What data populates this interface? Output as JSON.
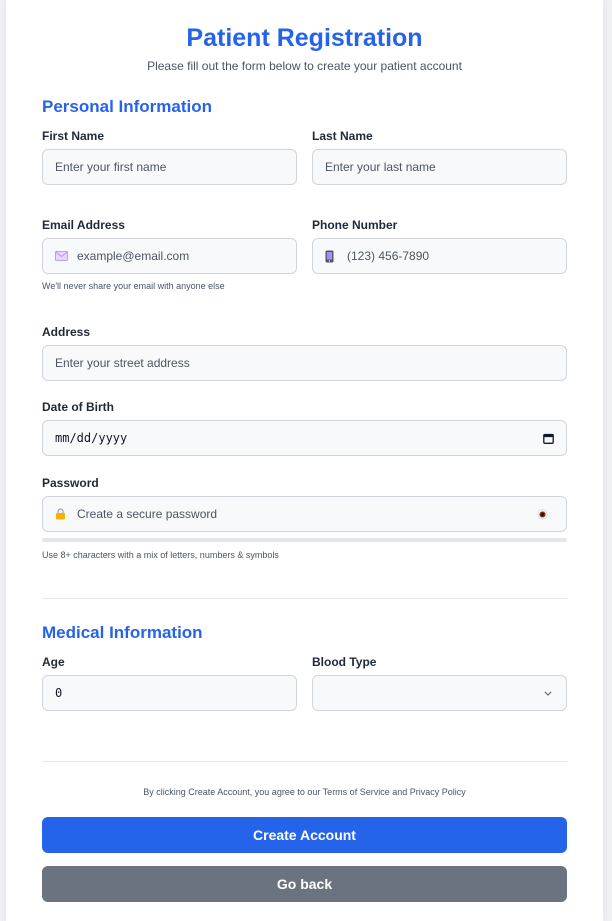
{
  "header": {
    "title": "Patient Registration",
    "subtitle": "Please fill out the form below to create your patient account"
  },
  "personal": {
    "section_title": "Personal Information",
    "first_name": {
      "label": "First Name",
      "placeholder": "Enter your first name"
    },
    "last_name": {
      "label": "Last Name",
      "placeholder": "Enter your last name"
    },
    "email": {
      "label": "Email Address",
      "placeholder": "example@email.com",
      "hint": "We'll never share your email with anyone else"
    },
    "phone": {
      "label": "Phone Number",
      "placeholder": "(123) 456-7890"
    },
    "address": {
      "label": "Address",
      "placeholder": "Enter your street address"
    },
    "dob": {
      "label": "Date of Birth",
      "value": "mm/dd/yyyy"
    },
    "password": {
      "label": "Password",
      "placeholder": "Create a secure password",
      "hint": "Use 8+ characters with a mix of letters, numbers & symbols",
      "strength": 0
    }
  },
  "medical": {
    "section_title": "Medical Information",
    "age": {
      "label": "Age",
      "value": "0"
    },
    "blood_type": {
      "label": "Blood Type",
      "value": ""
    }
  },
  "footer": {
    "terms": "By clicking Create Account, you agree to our Terms of Service and Privacy Policy",
    "create_label": "Create Account",
    "back_label": "Go back"
  },
  "colors": {
    "accent": "#2563eb",
    "secondary_button": "#6b7280",
    "input_bg": "#f8f9fb"
  },
  "icons": {
    "email": "envelope-icon",
    "phone": "mobile-phone-icon",
    "password": "lock-icon",
    "password_toggle": "eye-icon",
    "calendar": "calendar-icon",
    "select": "chevron-down-icon"
  }
}
